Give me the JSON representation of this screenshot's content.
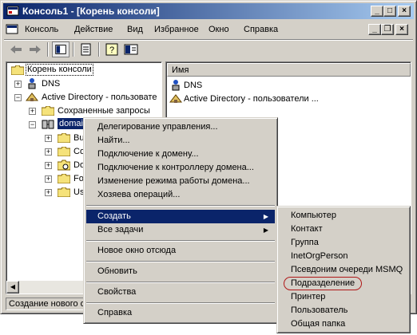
{
  "window": {
    "title": "Консоль1 - [Корень консоли]"
  },
  "menubar": {
    "items": [
      "Консоль",
      "Действие",
      "Вид",
      "Избранное",
      "Окно",
      "Справка"
    ]
  },
  "tree": {
    "root": "Корень консоли",
    "dns": "DNS",
    "ad": "Active Directory - пользовате",
    "saved": "Сохраненные запросы",
    "domain": "domain",
    "children": [
      "Bu",
      "Co",
      "Do",
      "Fo",
      "Us"
    ]
  },
  "list": {
    "header": "Имя",
    "items": [
      "DNS",
      "Active Directory - пользователи ..."
    ]
  },
  "status": {
    "text": "Создание нового о"
  },
  "context_menu": {
    "group1": [
      "Делегирование управления...",
      "Найти...",
      "Подключение к домену...",
      "Подключение к контроллеру домена...",
      "Изменение режима работы домена...",
      "Хозяева операций..."
    ],
    "create": "Создать",
    "all_tasks": "Все задачи",
    "new_window": "Новое окно отсюда",
    "refresh": "Обновить",
    "properties": "Свойства",
    "help": "Справка"
  },
  "submenu": {
    "items": [
      "Компьютер",
      "Контакт",
      "Группа",
      "InetOrgPerson",
      "Псевдоним очереди MSMQ",
      "Подразделение",
      "Принтер",
      "Пользователь",
      "Общая папка"
    ],
    "highlighted": "Подразделение"
  },
  "colors": {
    "title_start": "#0a246a",
    "title_end": "#a6caf0",
    "face": "#d4d0c8",
    "selection": "#0a246a",
    "highlight_oval": "#b01818"
  }
}
